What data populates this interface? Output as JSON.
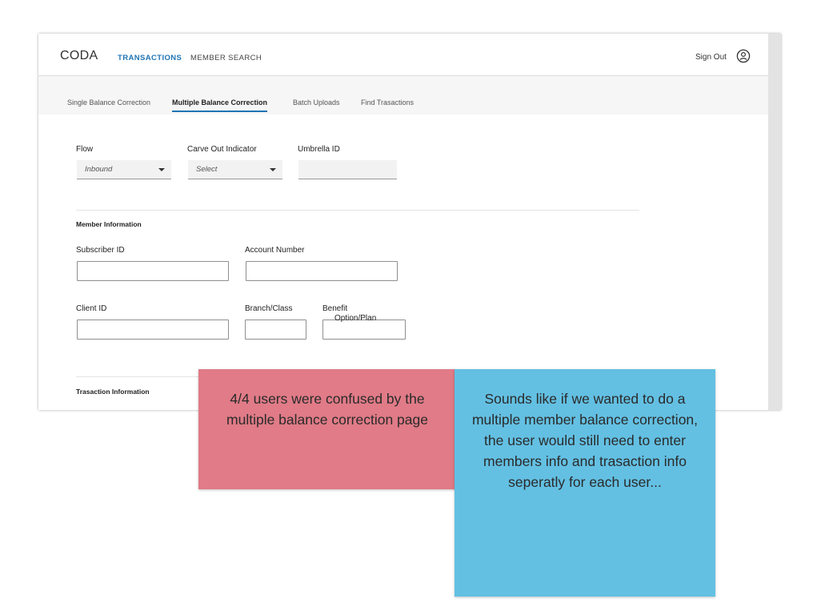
{
  "header": {
    "logo": "CODA",
    "nav": [
      "TRANSACTIONS",
      "MEMBER SEARCH"
    ],
    "sign_out": "Sign Out"
  },
  "tabs": [
    "Single Balance Correction",
    "Multiple Balance Correction",
    "Batch Uploads",
    "Find Trasactions"
  ],
  "form": {
    "flow_label": "Flow",
    "flow_value": "Inbound",
    "carve_out_label": "Carve Out Indicator",
    "carve_out_value": "Select",
    "umbrella_label": "Umbrella ID",
    "member_section": "Member Information",
    "subscriber_label": "Subscriber ID",
    "account_label": "Account Number",
    "client_label": "Client ID",
    "branch_label": "Branch/Class",
    "benefit_label_1": "Benefit",
    "benefit_label_2": "Option/Plan",
    "transaction_section": "Trasaction Information"
  },
  "notes": {
    "red": "4/4  users were confused by the multiple balance correction page",
    "blue": "Sounds like if we wanted to do a multiple member balance correction, the user would still need to enter members info and trasaction info seperatly for each user..."
  },
  "colors": {
    "accent": "#1f74b4",
    "note_red": "#e07b87",
    "note_blue": "#63c0e3"
  }
}
